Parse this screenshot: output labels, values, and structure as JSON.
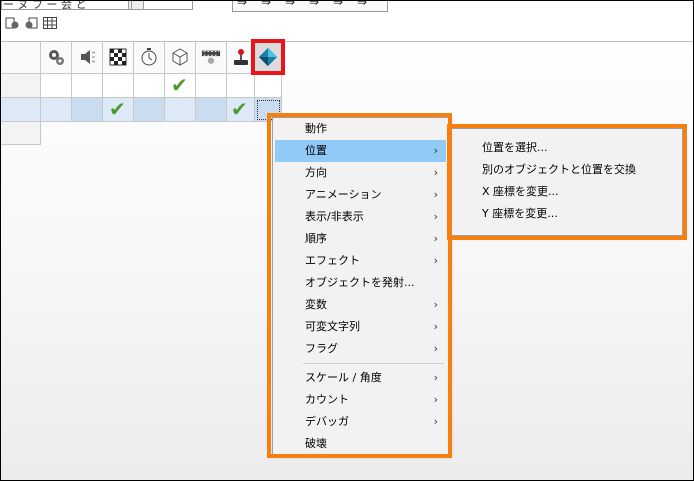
{
  "toolbar": {
    "tab_text": "ー ヌ フ ー 会 と",
    "icons": [
      "event-icon-a",
      "event-icon-b",
      "grid-icon"
    ],
    "right_glyphs": [
      "⇒",
      "⇒",
      "⇒",
      "⇒",
      "⇒",
      "⇒"
    ]
  },
  "grid": {
    "header_icons": [
      "gears-icon",
      "speaker-icon",
      "checker-icon",
      "timer-icon",
      "cube-icon",
      "film-icon",
      "joystick-icon",
      "diamond-object-icon"
    ],
    "row1_checks": [
      false,
      false,
      false,
      false,
      true,
      false,
      false,
      false
    ],
    "row2_checks": [
      false,
      false,
      true,
      false,
      false,
      false,
      true,
      false
    ],
    "check_glyph": "✔"
  },
  "menu": {
    "items": [
      {
        "label": "動作",
        "submenu": true
      },
      {
        "label": "位置",
        "submenu": true,
        "selected": true
      },
      {
        "label": "方向",
        "submenu": true
      },
      {
        "label": "アニメーション",
        "submenu": true
      },
      {
        "label": "表示/非表示",
        "submenu": true
      },
      {
        "label": "順序",
        "submenu": true
      },
      {
        "label": "エフェクト",
        "submenu": true
      },
      {
        "label": "オブジェクトを発射...",
        "submenu": false
      },
      {
        "label": "変数",
        "submenu": true
      },
      {
        "label": "可変文字列",
        "submenu": true
      },
      {
        "label": "フラグ",
        "submenu": true
      },
      {
        "label": "スケール / 角度",
        "submenu": true
      },
      {
        "label": "カウント",
        "submenu": true
      },
      {
        "label": "デバッガ",
        "submenu": true
      },
      {
        "label": "破壊",
        "submenu": false
      }
    ],
    "chevron": "›"
  },
  "submenu": {
    "items": [
      "位置を選択...",
      "別のオブジェクトと位置を交換",
      "X 座標を変更...",
      "Y 座標を変更..."
    ]
  },
  "colors": {
    "highlight_red": "#e8151b",
    "highlight_orange": "#f77f0f",
    "selected_item": "#91c9f7",
    "check_green": "#4e9a2c"
  }
}
